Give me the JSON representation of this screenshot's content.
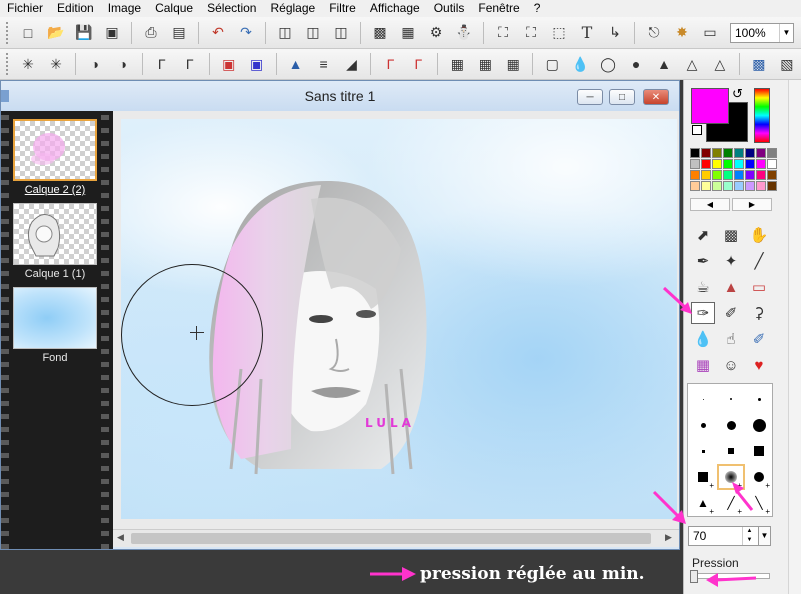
{
  "menu": [
    "Fichier",
    "Edition",
    "Image",
    "Calque",
    "Sélection",
    "Réglage",
    "Filtre",
    "Affichage",
    "Outils",
    "Fenêtre",
    "?"
  ],
  "toolbar": {
    "zoom_value": "100%"
  },
  "document": {
    "title": "Sans titre 1"
  },
  "layers": [
    {
      "label": "Calque 2 (2)",
      "active": true
    },
    {
      "label": "Calque 1 (1)",
      "active": false
    },
    {
      "label": "Fond",
      "active": false
    }
  ],
  "canvas": {
    "signature": "LULA"
  },
  "colors": {
    "primary": "#ff00ff",
    "secondary": "#000000",
    "annotation": "#ff33cc"
  },
  "brush_panel": {
    "size_value": "70",
    "pressure_label": "Pression"
  },
  "footer_note": "pression réglée au min."
}
